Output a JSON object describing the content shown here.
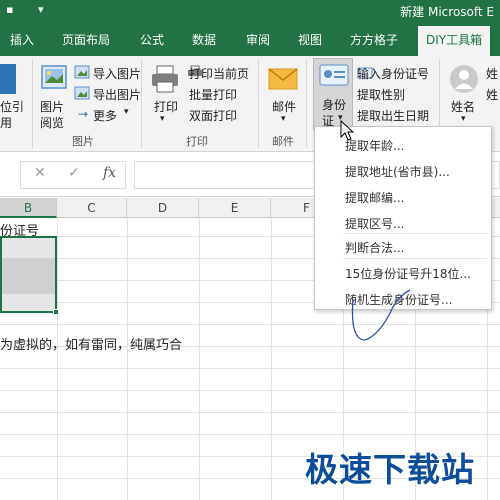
{
  "titlebar": {
    "title": "新建 Microsoft E"
  },
  "tabs": [
    "插入",
    "页面布局",
    "公式",
    "数据",
    "审阅",
    "视图",
    "方方格子",
    "DIY工具箱"
  ],
  "ribbon": {
    "left_partial": [
      "位引",
      "用"
    ],
    "image_group": {
      "big_label_1": "图片",
      "big_label_2": "阅览",
      "import_images": "导入图片",
      "export_images": "导出图片",
      "more": "更多",
      "group_title": "图片"
    },
    "print_group": {
      "print_label": "打印",
      "print_current_page": "打印当前页",
      "batch_print": "批量打印",
      "duplex_print": "双面打印",
      "group_title": "打印"
    },
    "mail_group": {
      "mail_label": "邮件",
      "group_title": "邮件"
    },
    "id_group": {
      "id_label_1": "身份",
      "id_label_2": "证",
      "enter_id": "输入身份证号",
      "extract_gender": "提取性别",
      "extract_birthday": "提取出生日期"
    },
    "name_group": {
      "name_label": "姓名",
      "partial_1": "姓",
      "partial_2": "姓"
    }
  },
  "formula_bar": {
    "cancel": "✕",
    "enter": "✓",
    "fx": "fx"
  },
  "columns": [
    "B",
    "C",
    "D",
    "E",
    "F"
  ],
  "cells": {
    "b1": "份证号",
    "note": "为虚拟的，如有雷同，纯属巧合"
  },
  "dropdown": {
    "items": [
      "提取年龄...",
      "提取地址(省市县)...",
      "提取邮编...",
      "提取区号...",
      "判断合法...",
      "15位身份证号升18位...",
      "随机生成身份证号..."
    ]
  },
  "watermark": "极速下载站",
  "colors": {
    "accent": "#217346",
    "ribbon_bg": "#f3f3f3",
    "watermark": "#0e4d9a"
  }
}
